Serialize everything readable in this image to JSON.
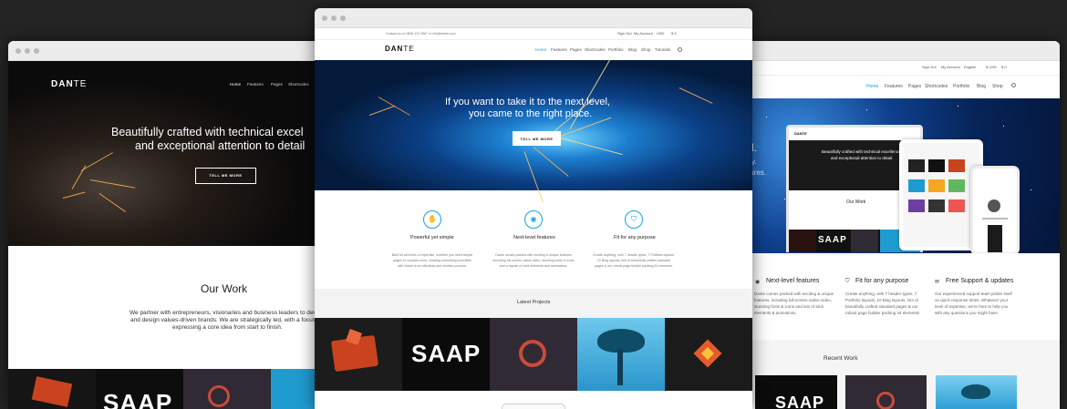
{
  "left": {
    "logo": {
      "bold": "DAN",
      "light": "TE"
    },
    "nav": [
      "Home",
      "Features",
      "Pages",
      "Shortcodes"
    ],
    "hero_line1": "Beautifully crafted with technical excel",
    "hero_line2": "and exceptional attention to detail",
    "hero_button": "TELL ME MORE",
    "section_title": "Our Work",
    "body_line1": "We partner with entrepreneurs, visionaries and business leaders to deve",
    "body_line2": "and design values-driven brands. We are strategically led, with a focus",
    "body_line3": "expressing a core idea from start to finish.",
    "saap": "SAAP"
  },
  "center": {
    "topbar_contact": "Contact us on 0800 123 4567 or info@dante.com",
    "topbar_links": [
      "Sign Out",
      "My Account",
      "USD",
      "$ 0"
    ],
    "logo": {
      "bold": "DAN",
      "light": "TE"
    },
    "nav": [
      "Home",
      "Features",
      "Pages",
      "Shortcodes",
      "Portfolio",
      "Blog",
      "Shop",
      "Tutorials"
    ],
    "hero_line1": "If you want to take it to the next level,",
    "hero_line2": "you came to the right place.",
    "hero_button": "TELL ME MORE",
    "features": [
      {
        "title": "Powerful yet simple",
        "line1": "Built for all levels of expertise, whether you need simple",
        "line2": "pages or complex ones, creating something incredible",
        "line3": "with Dante is an effortless and intuitive process."
      },
      {
        "title": "Next-level features",
        "line1": "Dante comes packed with exciting & unique features",
        "line2": "including full-screen native video, stunning fonts & icons",
        "line3": "and a myriad of slick elements and animations."
      },
      {
        "title": "Fit for any purpose",
        "line1": "Create anything, with 7 header types, 7 Portfolio layouts,",
        "line2": "10 Blog layouts, lots of beautifully crafted standard",
        "line3": "pages & our robust page builder packing 44 elements."
      }
    ],
    "latest_title": "Latest Projects",
    "saap": "SAAP"
  },
  "right": {
    "topbar_links": [
      "Sign Out",
      "My Account",
      "English",
      "$ USD",
      "$ 0"
    ],
    "nav": [
      "Home",
      "Features",
      "Pages",
      "Shortcodes",
      "Portfolio",
      "Blog",
      "Shop"
    ],
    "hero_fragment1": "l.",
    "hero_fragment2": "y.",
    "hero_fragment3": "tures.",
    "mock_logo": "DANTE",
    "mock_line1": "Beautifully crafted with technical excellence",
    "mock_line2": "and exceptional attention to detail.",
    "mock_section": "Our Work",
    "mock_saap": "SAAP",
    "features": [
      {
        "title": "Next-level features",
        "line1": "Dante comes packed with exciting & unique",
        "line2": "features, including full-screen native video,",
        "line3": "stunning fonts & icons and lots of slick",
        "line4": "elements & animations."
      },
      {
        "title": "Fit for any purpose",
        "line1": "Create anything, with 7 header types, 7",
        "line2": "Portfolio layouts, 10 Blog layouts, lots of",
        "line3": "beautifully crafted standard pages & our",
        "line4": "robust page builder packing 44 elements."
      },
      {
        "title": "Free Support & updates",
        "line1": "Our experienced support team prides itself",
        "line2": "on quick response times. Whatever your",
        "line3": "level of expertise, we're here to help you",
        "line4": "with any questions you might have."
      }
    ],
    "recent_title": "Recent Work",
    "saap": "SAAP"
  },
  "colors": {
    "accent": "#1aa3d6",
    "saap_red": "#d9472b",
    "dark": "#0b0b0b"
  }
}
